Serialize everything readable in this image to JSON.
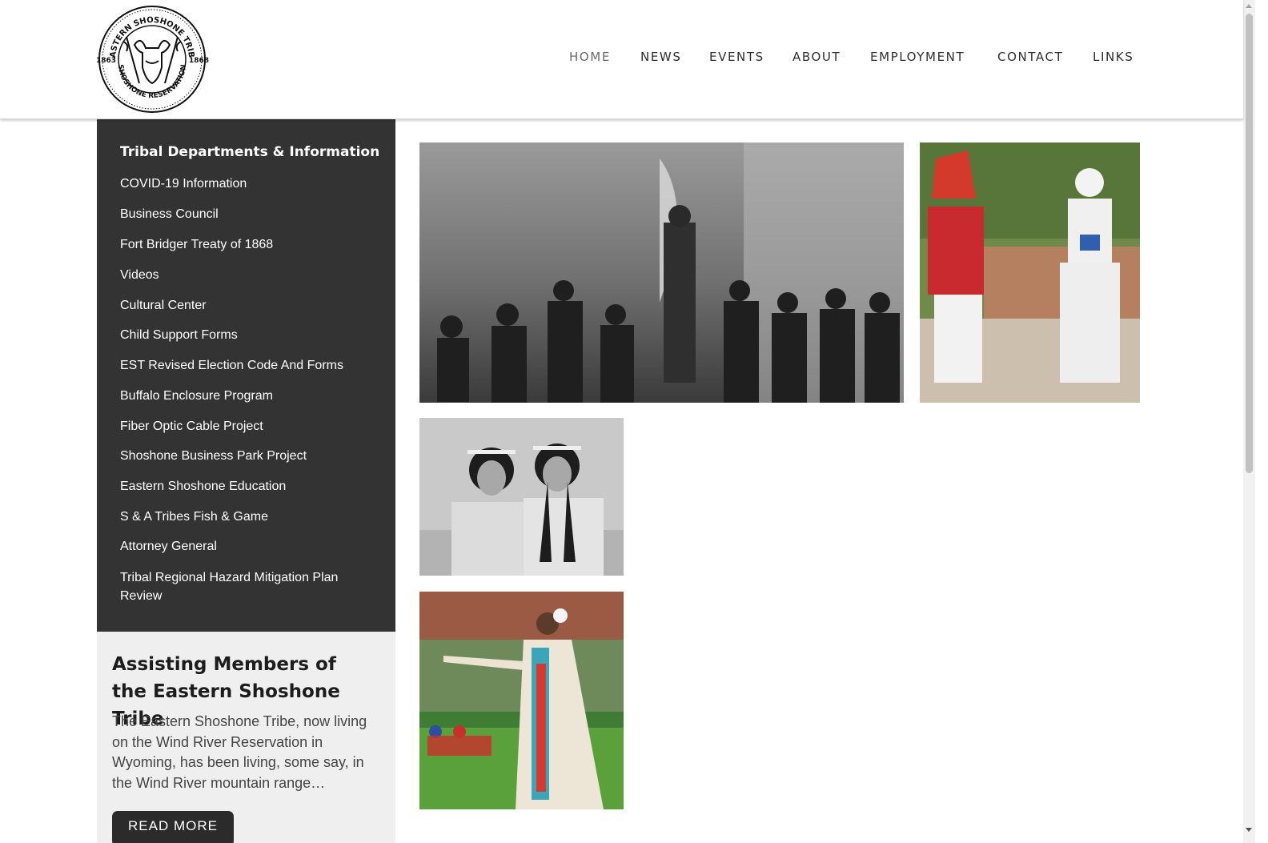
{
  "header": {
    "logo": {
      "name": "EASTERN SHOSHONE TRIBE",
      "bottom": "SHOSHONE RESERVATION",
      "year_left": "1863",
      "year_right": "1868"
    },
    "nav": [
      {
        "label": "HOME",
        "active": true
      },
      {
        "label": "NEWS"
      },
      {
        "label": "EVENTS"
      },
      {
        "label": "ABOUT"
      },
      {
        "label": "EMPLOYMENT"
      },
      {
        "label": "CONTACT"
      },
      {
        "label": "LINKS"
      }
    ]
  },
  "sidebar": {
    "title": "Tribal Departments & Information",
    "items": [
      "COVID-19 Information",
      "Business Council",
      "Fort Bridger Treaty of 1868",
      "Videos",
      "Cultural Center",
      "Child Support Forms",
      "EST Revised Election Code And Forms",
      "Buffalo Enclosure Program",
      "Fiber Optic Cable Project",
      "Shoshone Business Park Project",
      "Eastern Shoshone Education",
      "S & A Tribes Fish & Game",
      "Attorney General",
      "Tribal Regional Hazard Mitigation Plan Review"
    ]
  },
  "promo": {
    "title": "Assisting Members of the Eastern Shoshone Tribe",
    "body": "The Eastern Shoshone Tribe, now living on the Wind River Reservation in Wyoming, has been living, some say, in the Wind River mountain range…",
    "button": "READ MORE"
  },
  "gallery": [
    {
      "name": "historic-council-photo"
    },
    {
      "name": "ceremonial-dress-couple-photo"
    },
    {
      "name": "two-women-portrait-photo"
    },
    {
      "name": "dancer-in-regalia-photo"
    }
  ],
  "colors": {
    "sidebar_bg": "#333333",
    "promo_bg": "#efefef",
    "button_bg": "#2b2b2b",
    "nav_text": "#2e2e2e"
  }
}
